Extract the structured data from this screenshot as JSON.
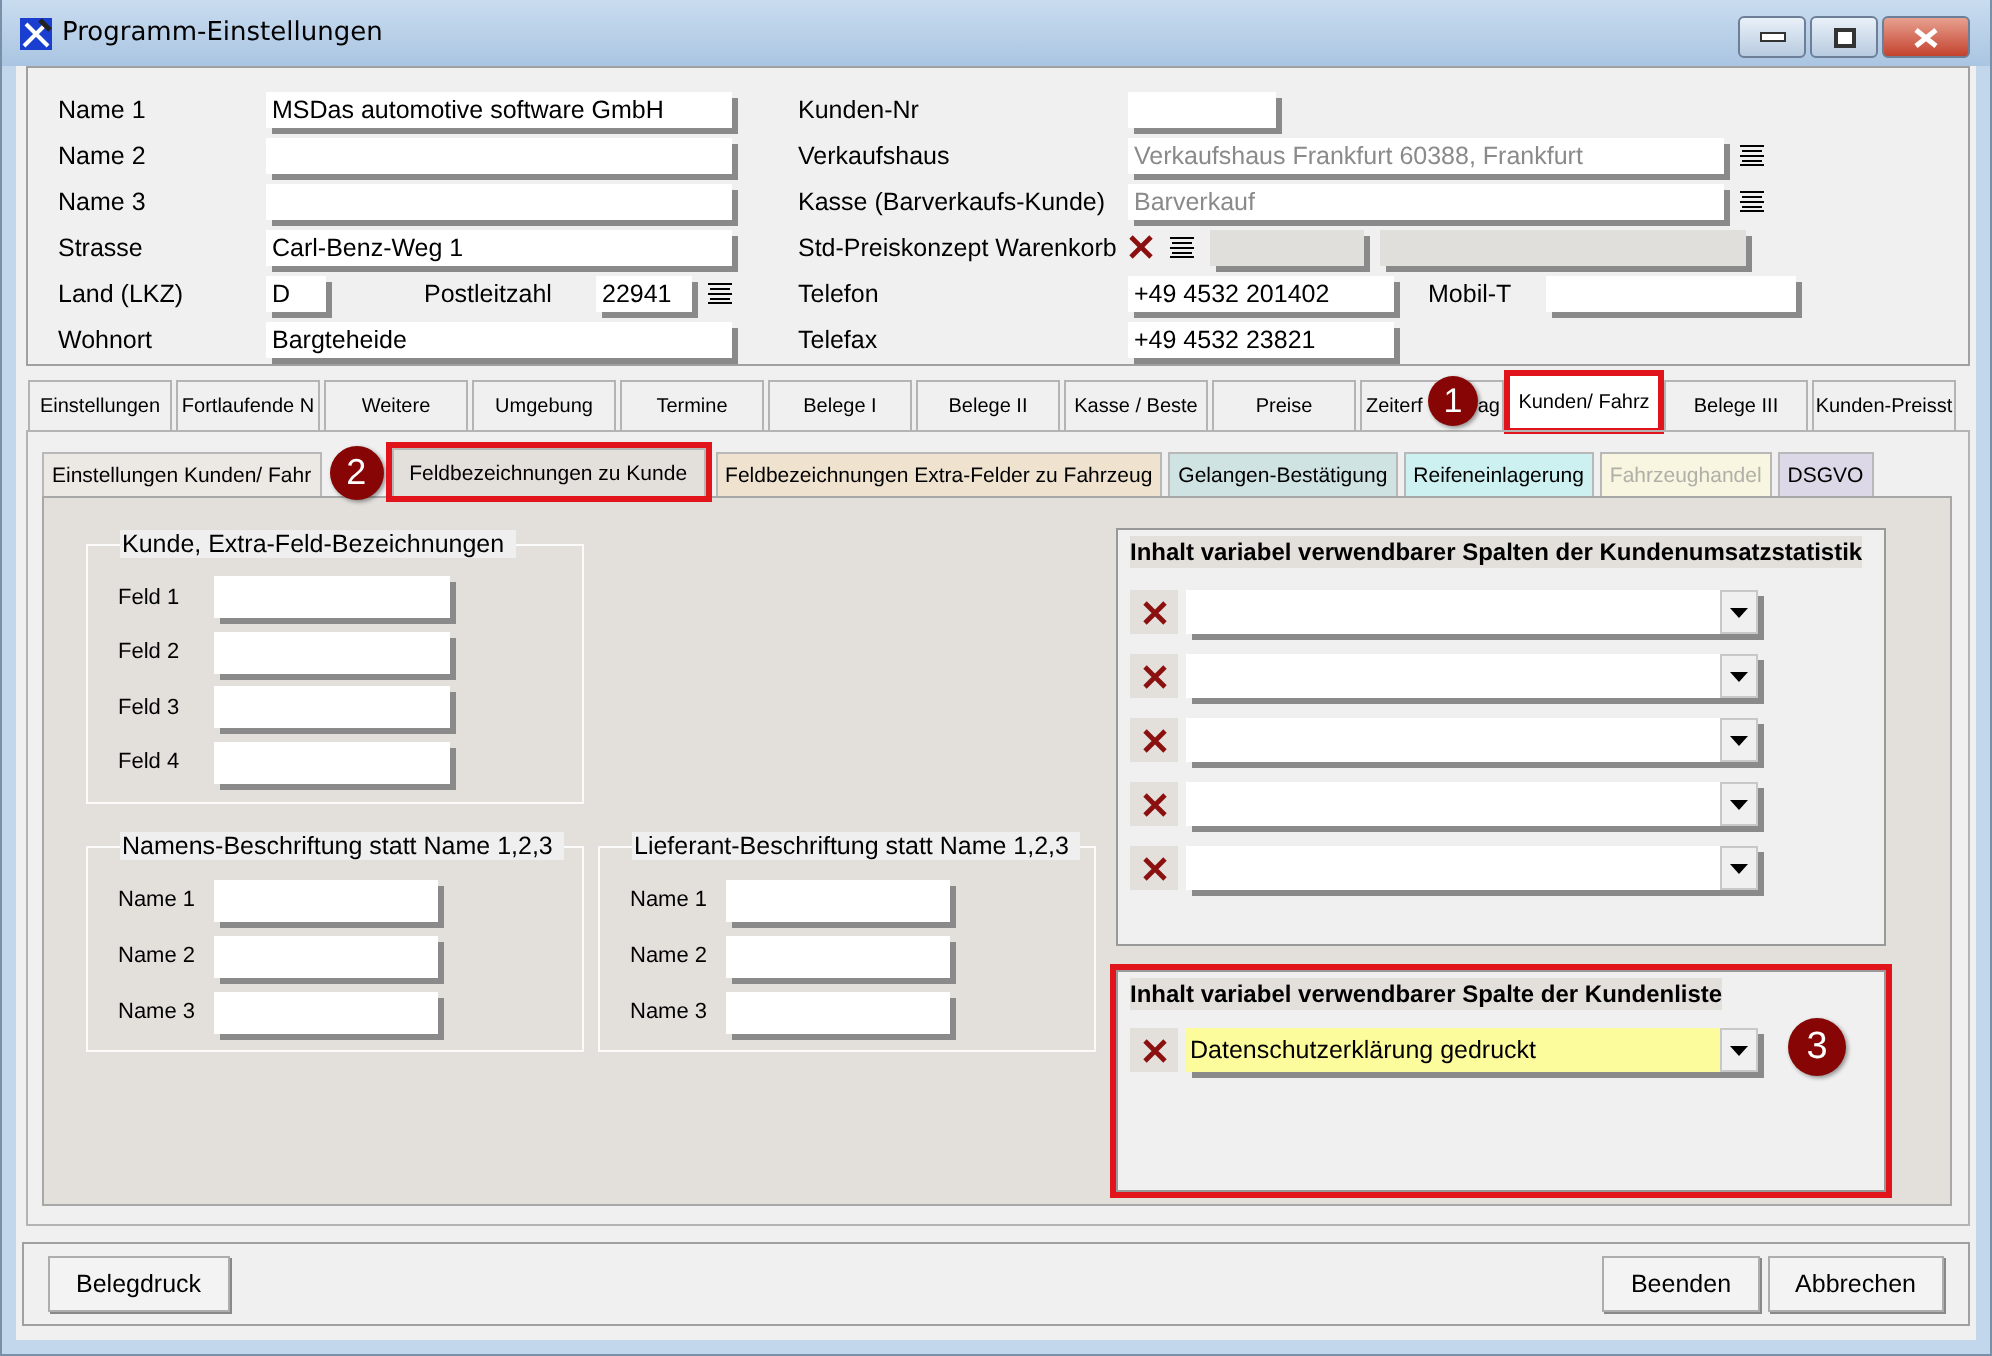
{
  "window": {
    "title": "Programm-Einstellungen"
  },
  "header": {
    "left": [
      {
        "label": "Name 1",
        "value": "MSDas automotive software GmbH"
      },
      {
        "label": "Name 2"
      },
      {
        "label": "Name 3"
      },
      {
        "label": "Strasse",
        "value": "Carl-Benz-Weg 1"
      }
    ],
    "country": {
      "label": "Land (LKZ)",
      "value": "D"
    },
    "postcode": {
      "label": "Postleitzahl",
      "value": "22941"
    },
    "city": {
      "label": "Wohnort",
      "value": "Bargteheide"
    },
    "customer_no": {
      "label": "Kunden-Nr"
    },
    "sales_house": {
      "label": "Verkaufshaus",
      "value": "Verkaufshaus Frankfurt 60388, Frankfurt",
      "disabled": true
    },
    "till": {
      "label": "Kasse (Barverkaufs-Kunde)",
      "value": "Barverkauf",
      "disabled": true
    },
    "price_concept": {
      "label": "Std-Preiskonzept Warenkorb"
    },
    "phone": {
      "label": "Telefon",
      "value": "+49 4532 201402"
    },
    "mobile": {
      "label": "Mobil-T"
    },
    "fax": {
      "label": "Telefax",
      "value": "+49 4532 23821"
    }
  },
  "tabs": [
    {
      "label": "Einstellungen",
      "selected": false,
      "highlighted": false
    },
    {
      "label": "Fortlaufende N",
      "selected": false,
      "highlighted": false
    },
    {
      "label": "Weitere",
      "selected": false,
      "highlighted": false
    },
    {
      "label": "Umgebung",
      "selected": false,
      "highlighted": false
    },
    {
      "label": "Termine",
      "selected": false,
      "highlighted": false
    },
    {
      "label": "Belege I",
      "selected": false,
      "highlighted": false
    },
    {
      "label": "Belege II",
      "selected": false,
      "highlighted": false
    },
    {
      "label": "Kasse / Beste",
      "selected": false,
      "highlighted": false
    },
    {
      "label": "Preise",
      "selected": false,
      "highlighted": false
    },
    {
      "label": "Zeiterf",
      "label_end": "ag",
      "selected": false,
      "highlighted": false
    },
    {
      "label": "Kunden/ Fahrz",
      "selected": true,
      "highlighted": true
    },
    {
      "label": "Belege III",
      "selected": false,
      "highlighted": false
    },
    {
      "label": "Kunden-Preisst",
      "selected": false,
      "highlighted": false
    }
  ],
  "subtabs": [
    {
      "label": "Einstellungen Kunden/ Fahr",
      "selected": false,
      "highlighted": false,
      "disabled": false,
      "color": "#ece9e4"
    },
    {
      "label": "Feldbezeichnungen zu Kunde",
      "selected": true,
      "highlighted": true,
      "disabled": false,
      "color": "#e3e0dc"
    },
    {
      "label": "Feldbezeichnungen Extra-Felder zu Fahrzeug",
      "selected": false,
      "highlighted": false,
      "disabled": false,
      "color": "#efe3d0"
    },
    {
      "label": "Gelangen-Bestätigung",
      "selected": false,
      "highlighted": false,
      "disabled": false,
      "color": "#cfe3e3"
    },
    {
      "label": "Reifeneinlagerung",
      "selected": false,
      "highlighted": false,
      "disabled": false,
      "color": "#cdf0f0"
    },
    {
      "label": "Fahrzeughandel",
      "selected": false,
      "highlighted": false,
      "disabled": true,
      "color": "#f8f6e0"
    },
    {
      "label": "DSGVO",
      "selected": false,
      "highlighted": false,
      "disabled": false,
      "color": "#ddd8e8"
    }
  ],
  "extra_fields": {
    "title": "Kunde, Extra-Feld-Bezeichnungen",
    "fields": [
      {
        "label": "Feld 1"
      },
      {
        "label": "Feld 2"
      },
      {
        "label": "Feld 3"
      },
      {
        "label": "Feld 4"
      }
    ]
  },
  "name_labels": {
    "title": "Namens-Beschriftung statt Name 1,2,3",
    "fields": [
      {
        "label": "Name 1"
      },
      {
        "label": "Name 2"
      },
      {
        "label": "Name 3"
      }
    ]
  },
  "supplier_labels": {
    "title": "Lieferant-Beschriftung statt Name 1,2,3",
    "fields": [
      {
        "label": "Name 1"
      },
      {
        "label": "Name 2"
      },
      {
        "label": "Name 3"
      }
    ]
  },
  "column_groups": [
    {
      "title": "Inhalt variabel verwendbarer Spalten der Kundenumsatzstatistik",
      "highlighted": false,
      "rows": [
        {
          "highlighted": false
        },
        {
          "highlighted": false
        },
        {
          "highlighted": false
        },
        {
          "highlighted": false
        },
        {
          "highlighted": false
        }
      ]
    },
    {
      "title": "Inhalt variabel verwendbarer Spalte der Kundenliste",
      "highlighted": true,
      "rows": [
        {
          "value": "Datenschutzerklärung gedruckt",
          "highlighted": true
        }
      ]
    }
  ],
  "buttons_left": [
    "Belegdruck"
  ],
  "buttons_right": [
    "Beenden",
    "Abbrechen"
  ],
  "callouts": [
    {
      "number": "1"
    },
    {
      "number": "2"
    },
    {
      "number": "3"
    }
  ]
}
